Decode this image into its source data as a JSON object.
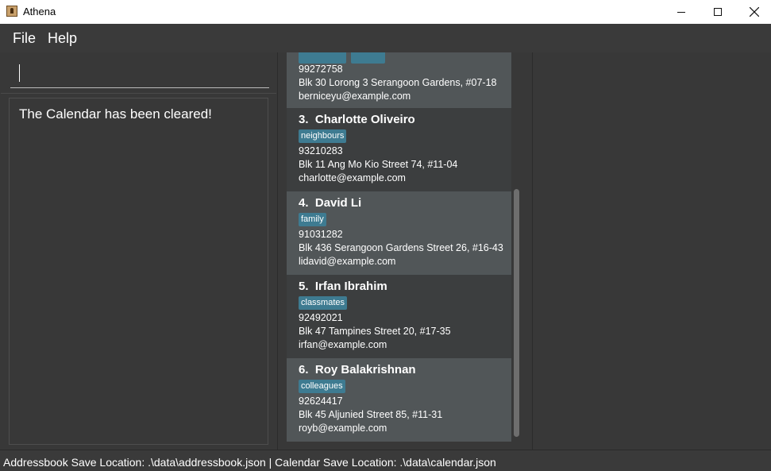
{
  "window": {
    "title": "Athena",
    "app_icon": "athena-app-icon"
  },
  "menu": {
    "items": [
      "File",
      "Help"
    ]
  },
  "command": {
    "value": "",
    "placeholder": ""
  },
  "result": {
    "message": "The Calendar has been cleared!"
  },
  "contacts": [
    {
      "index": "",
      "name": "",
      "tags": [
        "",
        ""
      ],
      "phone": "99272758",
      "address": "Blk 30 Lorong 3 Serangoon Gardens, #07-18",
      "email": "berniceyu@example.com"
    },
    {
      "index": "3.",
      "name": "Charlotte Oliveiro",
      "tags": [
        "neighbours"
      ],
      "phone": "93210283",
      "address": "Blk 11 Ang Mo Kio Street 74, #11-04",
      "email": "charlotte@example.com"
    },
    {
      "index": "4.",
      "name": "David Li",
      "tags": [
        "family"
      ],
      "phone": "91031282",
      "address": "Blk 436 Serangoon Gardens Street 26, #16-43",
      "email": "lidavid@example.com"
    },
    {
      "index": "5.",
      "name": "Irfan Ibrahim",
      "tags": [
        "classmates"
      ],
      "phone": "92492021",
      "address": "Blk 47 Tampines Street 20, #17-35",
      "email": "irfan@example.com"
    },
    {
      "index": "6.",
      "name": "Roy Balakrishnan",
      "tags": [
        "colleagues"
      ],
      "phone": "92624417",
      "address": "Blk 45 Aljunied Street 85, #11-31",
      "email": "royb@example.com"
    }
  ],
  "status": {
    "text": "Addressbook Save Location: .\\data\\addressbook.json | Calendar Save Location: .\\data\\calendar.json"
  },
  "colors": {
    "tag": "#3e7b91",
    "card_light": "#515658",
    "card_dark": "#3c3e3f",
    "background": "#383838"
  }
}
